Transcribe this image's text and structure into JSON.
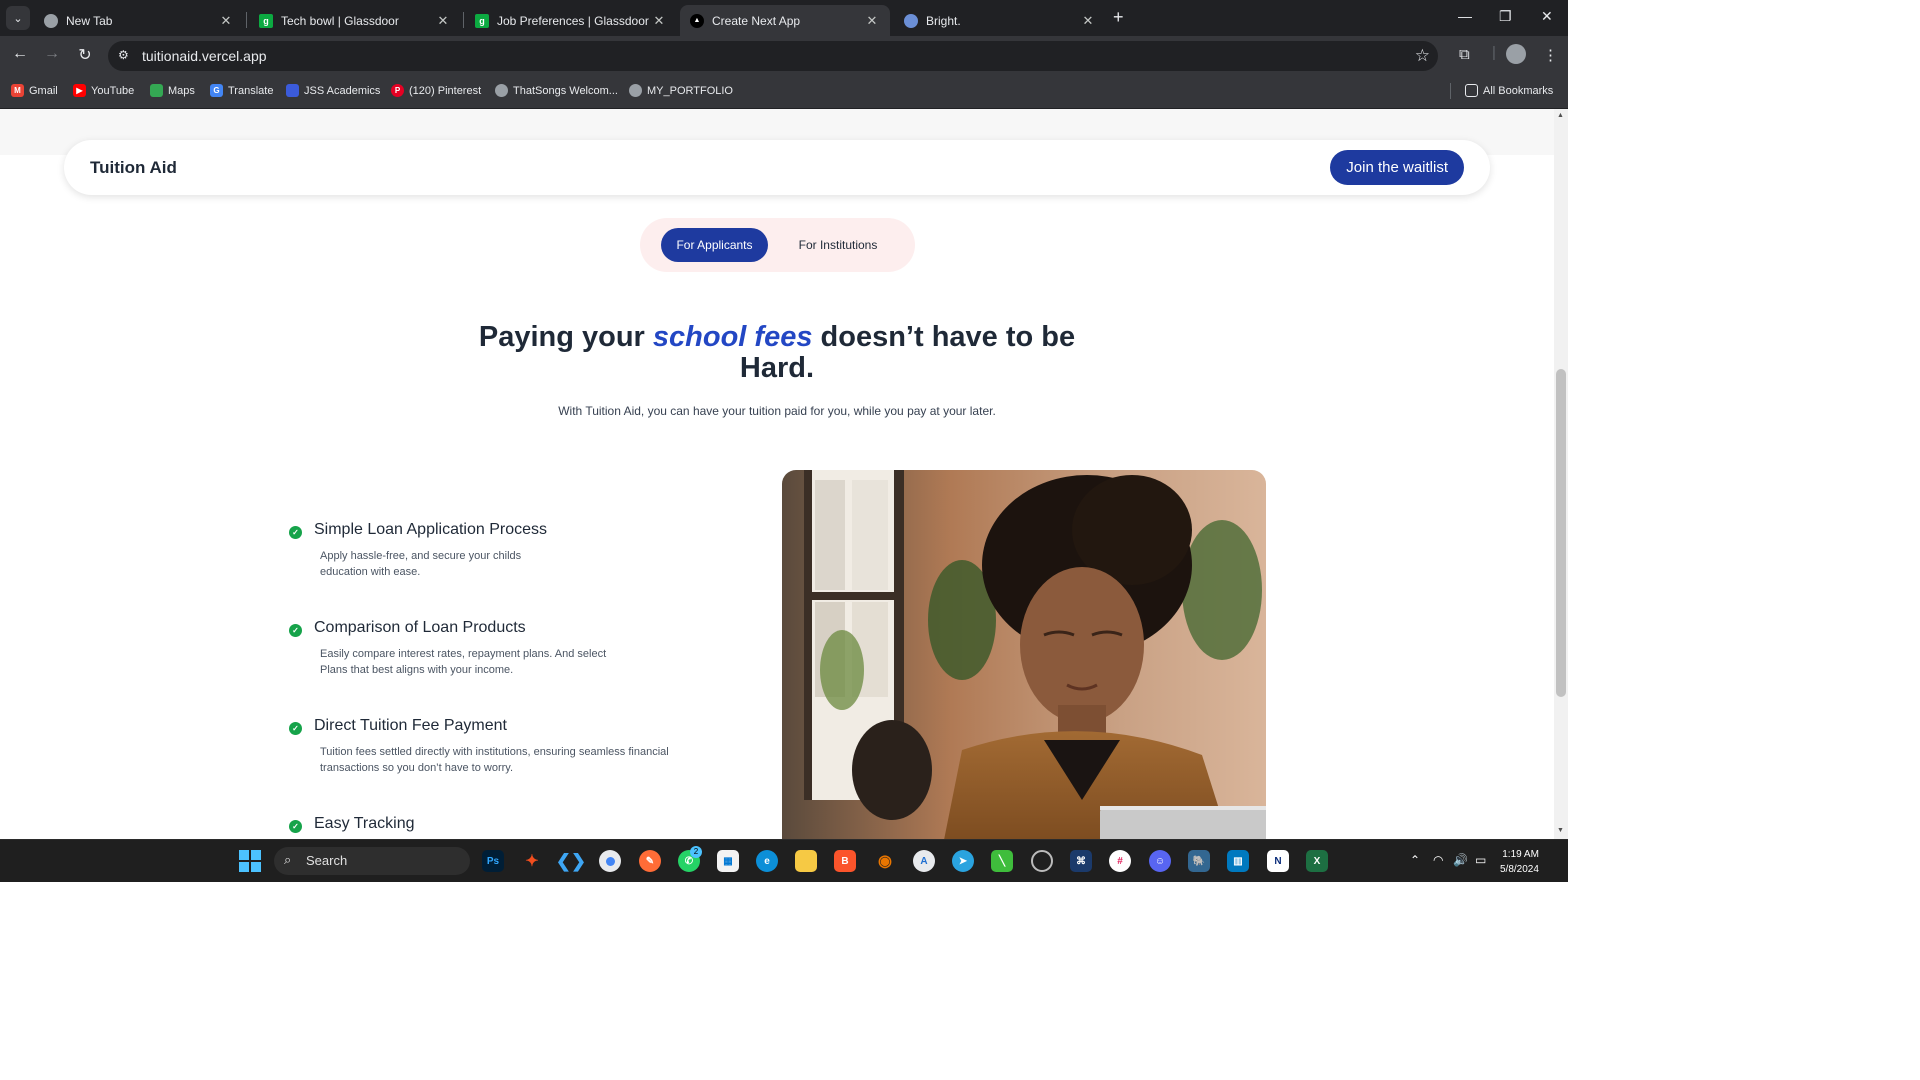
{
  "browser": {
    "tabs": [
      {
        "title": "New Tab",
        "active": false
      },
      {
        "title": "Tech bowl | Glassdoor",
        "active": false
      },
      {
        "title": "Job Preferences | Glassdoor",
        "active": false
      },
      {
        "title": "Create Next App",
        "active": true
      },
      {
        "title": "Bright.",
        "active": false
      }
    ],
    "url": "tuitionaid.vercel.app",
    "bookmarks": [
      {
        "label": "Gmail",
        "icon": "gmail-icon",
        "color": "#ea4335"
      },
      {
        "label": "YouTube",
        "icon": "youtube-icon",
        "color": "#ff0000"
      },
      {
        "label": "Maps",
        "icon": "maps-icon",
        "color": "#34a853"
      },
      {
        "label": "Translate",
        "icon": "translate-icon",
        "color": "#4285f4"
      },
      {
        "label": "JSS Academics",
        "icon": "jss-icon",
        "color": "#3b5bdb"
      },
      {
        "label": "(120) Pinterest",
        "icon": "pinterest-icon",
        "color": "#e60023"
      },
      {
        "label": "ThatSongs Welcom...",
        "icon": "globe-icon",
        "color": "#9aa0a6"
      },
      {
        "label": "MY_PORTFOLIO",
        "icon": "globe-icon",
        "color": "#9aa0a6"
      }
    ],
    "all_bookmarks": "All Bookmarks"
  },
  "page": {
    "brand": "Tuition Aid",
    "cta": "Join the waitlist",
    "toggle": {
      "active": "For Applicants",
      "inactive": "For Institutions"
    },
    "headline": {
      "pre": "Paying your ",
      "emphasis": "school fees",
      "post": " doesn’t have to be Hard."
    },
    "subheadline": "With Tuition Aid, you can have your tuition paid for you, while you pay at your later.",
    "features": [
      {
        "title": "Simple Loan Application Process",
        "desc_lines": [
          "Apply hassle-free, and secure your childs",
          "education with ease."
        ]
      },
      {
        "title": "Comparison of Loan Products",
        "desc_lines": [
          "Easily compare interest rates, repayment plans. And select",
          "Plans that best aligns with your income."
        ]
      },
      {
        "title": "Direct Tuition Fee Payment",
        "desc_lines": [
          "Tuition fees settled directly with institutions, ensuring seamless financial",
          "transactions so you don’t have to worry."
        ]
      },
      {
        "title": "Easy Tracking",
        "desc_lines": []
      }
    ],
    "colors": {
      "primary": "#1e3a9f",
      "accent_italic": "#2347c4",
      "toggle_bg": "#fdeeee",
      "check": "#16a34a"
    }
  },
  "taskbar": {
    "search": "Search",
    "apps": [
      "windows-start-icon",
      "photoshop-icon",
      "figma-icon",
      "vscode-icon",
      "chrome-icon",
      "postman-icon",
      "whatsapp-icon",
      "store-icon",
      "edge-icon",
      "file-explorer-icon",
      "brave-icon",
      "blender-icon",
      "app-icon",
      "telegram-icon",
      "app-icon",
      "obs-icon",
      "app-icon",
      "slack-icon",
      "discord-icon",
      "postgres-icon",
      "trello-icon",
      "notion-icon",
      "excel-icon"
    ],
    "whatsapp_badge": "2",
    "time": "1:19 AM",
    "date": "5/8/2024"
  }
}
